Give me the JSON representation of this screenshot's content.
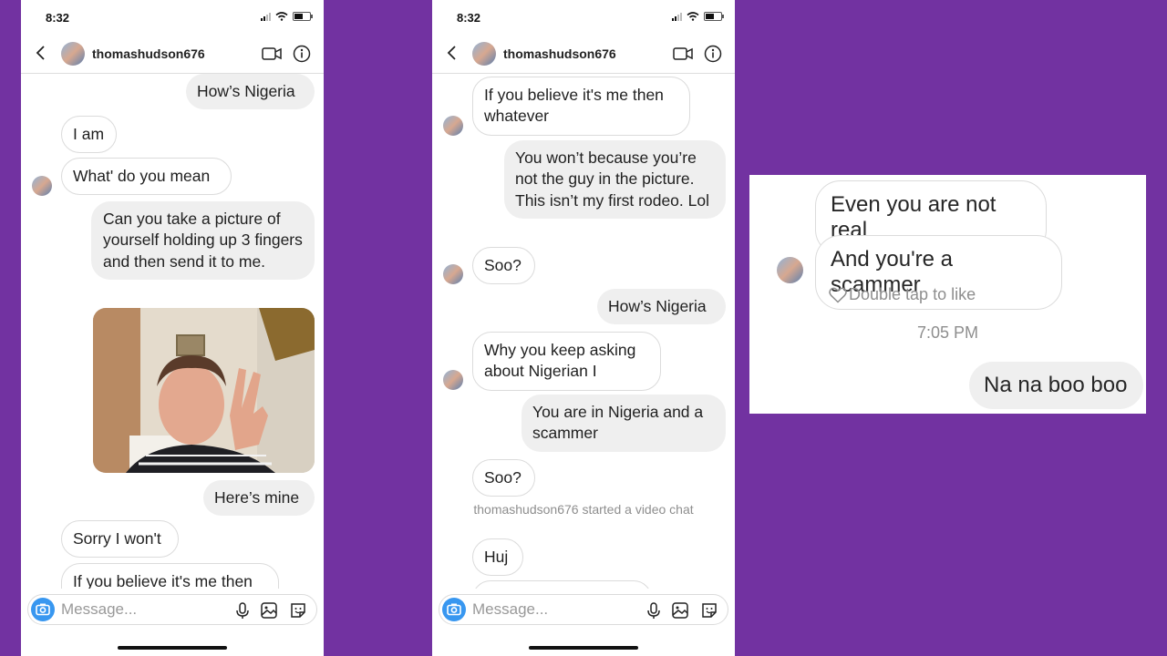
{
  "status_bar": {
    "time": "8:32"
  },
  "header": {
    "username": "thomashudson676"
  },
  "composer": {
    "placeholder": "Message..."
  },
  "phone1": {
    "messages": [
      {
        "text": "How’s Nigeria"
      },
      {
        "text": "I am"
      },
      {
        "text": "What' do you mean"
      },
      {
        "text": "Can you take a picture of yourself holding up 3 fingers and then send it to me."
      },
      {
        "text": "Here’s mine"
      },
      {
        "text": "Sorry I won't"
      },
      {
        "text": "If you believe it's me then"
      }
    ]
  },
  "phone2": {
    "messages": [
      {
        "text": "If you believe it's me then whatever"
      },
      {
        "text": "You won’t because you’re not the guy in the picture. This isn’t my first rodeo. Lol"
      },
      {
        "text": "Soo?"
      },
      {
        "text": "How’s Nigeria"
      },
      {
        "text": "Why you keep asking about Nigerian I"
      },
      {
        "text": "You are in Nigeria and a scammer"
      },
      {
        "text": "Soo?"
      },
      {
        "text": "Huj"
      }
    ],
    "system_message": "thomashudson676 started a video chat"
  },
  "panel3": {
    "messages": [
      {
        "text": "Even you are not real"
      },
      {
        "text": "And you're a scammer"
      },
      {
        "text": "Na na boo boo"
      }
    ],
    "double_tap_hint": "Double tap to like",
    "timestamp": "7:05 PM"
  },
  "colors": {
    "background": "#7232a1",
    "incoming_bubble": "#ffffff",
    "incoming_border": "#dbdbdb",
    "outgoing_bubble": "#efefef",
    "camera_button": "#3897f0",
    "secondary_text": "#8e8e8e"
  },
  "icons": [
    "back-chevron-icon",
    "video-call-icon",
    "info-icon",
    "camera-icon",
    "microphone-icon",
    "gallery-icon",
    "sticker-icon",
    "heart-icon",
    "signal-icon",
    "wifi-icon",
    "battery-icon"
  ]
}
